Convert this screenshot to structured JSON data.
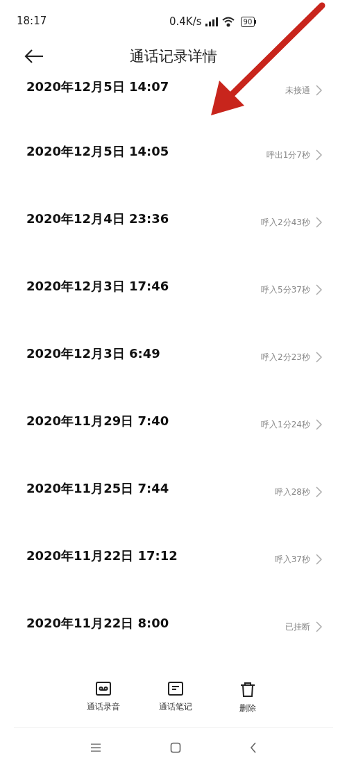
{
  "status_bar": {
    "time": "18:17",
    "speed": "0.4K/s",
    "battery": "90"
  },
  "header": {
    "title": "通话记录详情"
  },
  "calls": [
    {
      "datetime": "2020年12月5日 14:07",
      "status": "未接通"
    },
    {
      "datetime": "2020年12月5日 14:05",
      "status": "呼出1分7秒"
    },
    {
      "datetime": "2020年12月4日 23:36",
      "status": "呼入2分43秒"
    },
    {
      "datetime": "2020年12月3日 17:46",
      "status": "呼入5分37秒"
    },
    {
      "datetime": "2020年12月3日 6:49",
      "status": "呼入2分23秒"
    },
    {
      "datetime": "2020年11月29日 7:40",
      "status": "呼入1分24秒"
    },
    {
      "datetime": "2020年11月25日 7:44",
      "status": "呼入28秒"
    },
    {
      "datetime": "2020年11月22日 17:12",
      "status": "呼入37秒"
    },
    {
      "datetime": "2020年11月22日 8:00",
      "status": "已挂断"
    }
  ],
  "toolbar": [
    {
      "kind": "recording",
      "label": "通话录音"
    },
    {
      "kind": "notes",
      "label": "通话笔记"
    },
    {
      "kind": "delete",
      "label": "删除"
    }
  ]
}
